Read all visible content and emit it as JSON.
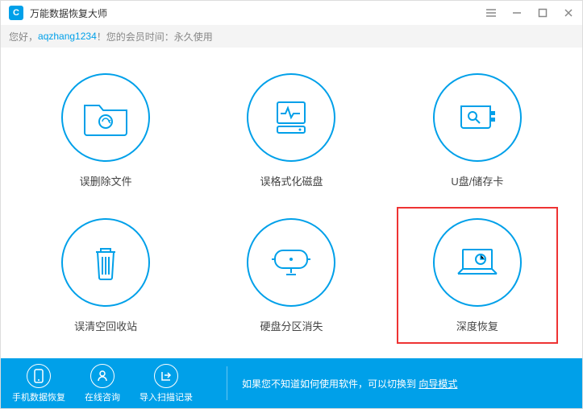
{
  "titlebar": {
    "app_name": "万能数据恢复大师"
  },
  "greeting": {
    "hello": "您好，",
    "username": "aqzhang1234",
    "suffix": "！您的会员时间：永久使用"
  },
  "options": {
    "deleted_files": "误删除文件",
    "formatted_disk": "误格式化磁盘",
    "usb_card": "U盘/储存卡",
    "recycle_bin": "误清空回收站",
    "partition_lost": "硬盘分区消失",
    "deep_recovery": "深度恢复"
  },
  "footer": {
    "phone_recovery": "手机数据恢复",
    "online_consult": "在线咨询",
    "import_scan": "导入扫描记录",
    "hint_prefix": "如果您不知道如何使用软件，可以切换到 ",
    "hint_link": "向导模式"
  }
}
